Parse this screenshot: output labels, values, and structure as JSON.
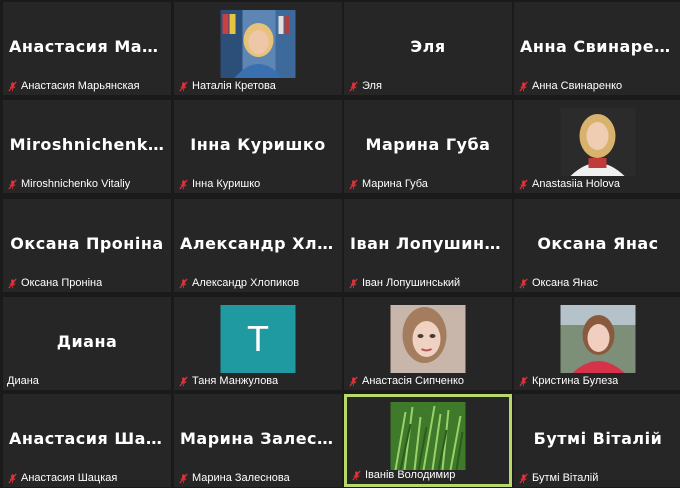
{
  "tiles": [
    {
      "big": "Анастасия Мар…",
      "label": "Анастасия Марьянская",
      "photo": null,
      "muted": true
    },
    {
      "big": "",
      "label": "Наталія Кретова",
      "photo": "office",
      "muted": true
    },
    {
      "big": "Эля",
      "label": "Эля",
      "photo": null,
      "muted": true
    },
    {
      "big": "Анна Свинарен…",
      "label": "Анна Свинаренко",
      "photo": null,
      "muted": true
    },
    {
      "big": "Miroshnichenk…",
      "label": "Miroshnichenko Vitaliy",
      "photo": null,
      "muted": true
    },
    {
      "big": "Інна Куришко",
      "label": "Інна Куришко",
      "photo": null,
      "muted": true
    },
    {
      "big": "Марина Губа",
      "label": "Марина Губа",
      "photo": null,
      "muted": true
    },
    {
      "big": "",
      "label": "Anastasiia Holova",
      "photo": "girl-blonde",
      "muted": true
    },
    {
      "big": "Оксана Проніна",
      "label": "Оксана Проніна",
      "photo": null,
      "muted": true
    },
    {
      "big": "Александр Хло…",
      "label": "Александр Хлопиков",
      "photo": null,
      "muted": true
    },
    {
      "big": "Іван Лопушинс…",
      "label": "Іван Лопушинський",
      "photo": null,
      "muted": true
    },
    {
      "big": "Оксана Янас",
      "label": "Оксана Янас",
      "photo": null,
      "muted": true
    },
    {
      "big": "Диана",
      "label": "Диана",
      "photo": null,
      "muted": false
    },
    {
      "big": "",
      "label": "Таня Манжулова",
      "photo": "avatar-t",
      "muted": true
    },
    {
      "big": "",
      "label": "Анастасія Сипченко",
      "photo": "woman-selfie",
      "muted": true
    },
    {
      "big": "",
      "label": "Кристина Булеза",
      "photo": "girl-outdoor",
      "muted": true
    },
    {
      "big": "Анастасия Шац…",
      "label": "Анастасия Шацкая",
      "photo": null,
      "muted": true
    },
    {
      "big": "Марина Залесн…",
      "label": "Марина Залеснова",
      "photo": null,
      "muted": true
    },
    {
      "big": "",
      "label": "Іванів Володимир",
      "photo": "grass",
      "muted": true,
      "active": true
    },
    {
      "big": "Бутмі Віталій",
      "label": "Бутмі Віталій",
      "photo": null,
      "muted": true
    }
  ],
  "avatar_letter": "T",
  "colors": {
    "muted_mic": "#e0333b",
    "active_border": "#b8d96a",
    "tile_bg": "#262626",
    "avatar_teal": "#1f9aa0"
  },
  "icons": {
    "muted": "muted-mic-icon"
  }
}
